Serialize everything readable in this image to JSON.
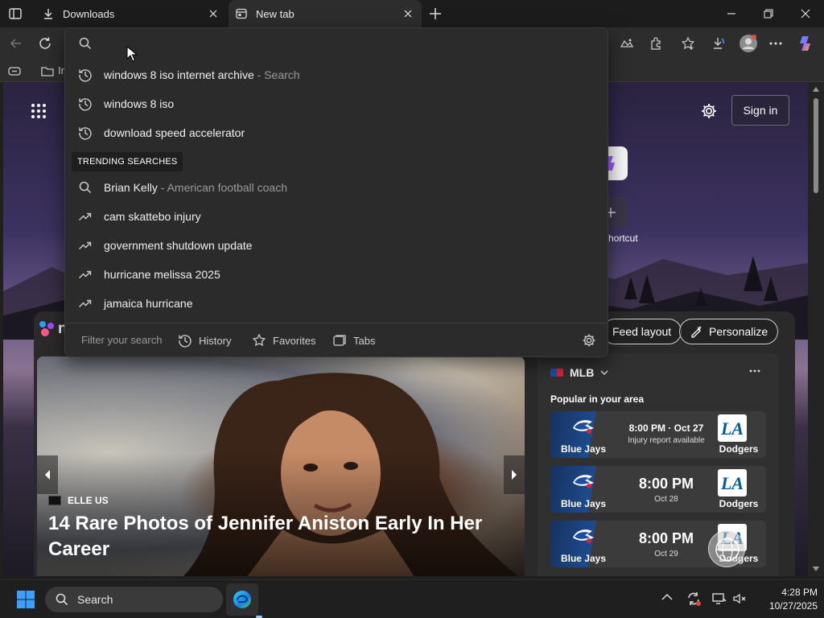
{
  "tabs": [
    {
      "label": "Downloads",
      "icon": "download-icon"
    },
    {
      "label": "New tab",
      "icon": "newtab-icon"
    }
  ],
  "ntp": {
    "sign_in_label": "Sign in",
    "shortcut_label": "hortcut",
    "bookmark_fragment": "Ir",
    "feed_layout_label": "Feed layout",
    "personalize_label": "Personalize",
    "brand_fragment": "n"
  },
  "omnibox": {
    "history": [
      {
        "text": "windows 8 iso internet archive",
        "suffix": " - Search"
      },
      {
        "text": "windows 8 iso",
        "suffix": ""
      },
      {
        "text": "download speed accelerator",
        "suffix": ""
      }
    ],
    "trending_label": "TRENDING SEARCHES",
    "trending": [
      {
        "text": "Brian Kelly",
        "suffix": " - American football coach",
        "icon": "search-icon"
      },
      {
        "text": "cam skattebo injury",
        "suffix": "",
        "icon": "trending-icon"
      },
      {
        "text": "government shutdown update",
        "suffix": "",
        "icon": "trending-icon"
      },
      {
        "text": "hurricane melissa 2025",
        "suffix": "",
        "icon": "trending-icon"
      },
      {
        "text": "jamaica hurricane",
        "suffix": "",
        "icon": "trending-icon"
      }
    ],
    "filter_placeholder": "Filter your search",
    "filters": {
      "history": "History",
      "favorites": "Favorites",
      "tabs": "Tabs"
    }
  },
  "hero": {
    "source": "ELLE US",
    "headline": "14 Rare Photos of Jennifer Aniston Early In Her Career"
  },
  "sports": {
    "league": "MLB",
    "subtitle": "Popular in your area",
    "games": [
      {
        "away": "Blue Jays",
        "home": "Dodgers",
        "time": "8:00 PM · Oct 27",
        "sub": "Injury report available"
      },
      {
        "away": "Blue Jays",
        "home": "Dodgers",
        "time": "8:00 PM",
        "sub": "Oct 28"
      },
      {
        "away": "Blue Jays",
        "home": "Dodgers",
        "time": "8:00 PM",
        "sub": "Oct 29"
      }
    ]
  },
  "taskbar": {
    "search_label": "Search",
    "time": "4:28 PM",
    "date": "10/27/2025"
  },
  "colors": {
    "accent": "#0a84ff",
    "dodgers_blue": "#005a9c",
    "bluejays_blue": "#134a8e"
  }
}
